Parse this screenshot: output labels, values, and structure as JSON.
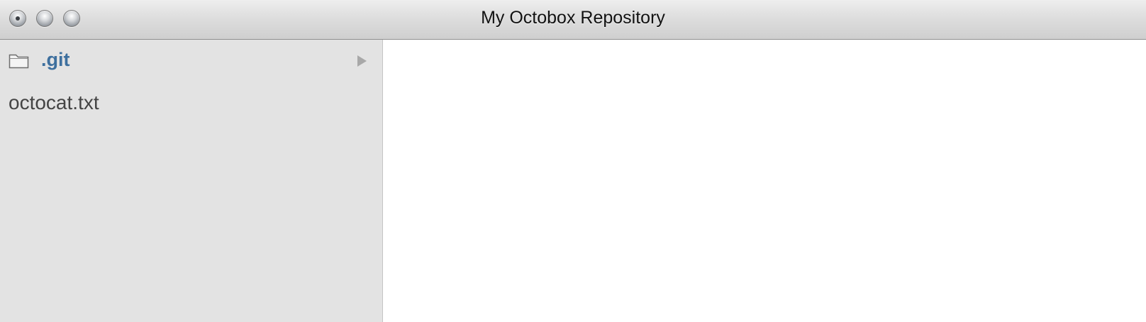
{
  "window": {
    "title": "My Octobox Repository"
  },
  "titlebar": {
    "buttons": [
      {
        "name": "close",
        "icon": "close-icon"
      },
      {
        "name": "minimize",
        "icon": "minimize-icon"
      },
      {
        "name": "zoom",
        "icon": "zoom-icon"
      }
    ]
  },
  "sidebar": {
    "items": [
      {
        "type": "folder",
        "label": ".git",
        "icon": "folder-icon",
        "expand_icon": "chevron-right-icon"
      },
      {
        "type": "file",
        "label": "octocat.txt"
      }
    ]
  },
  "colors": {
    "folder_label": "#3d6f9e",
    "file_label": "#444444",
    "sidebar_bg": "#e3e3e3"
  }
}
